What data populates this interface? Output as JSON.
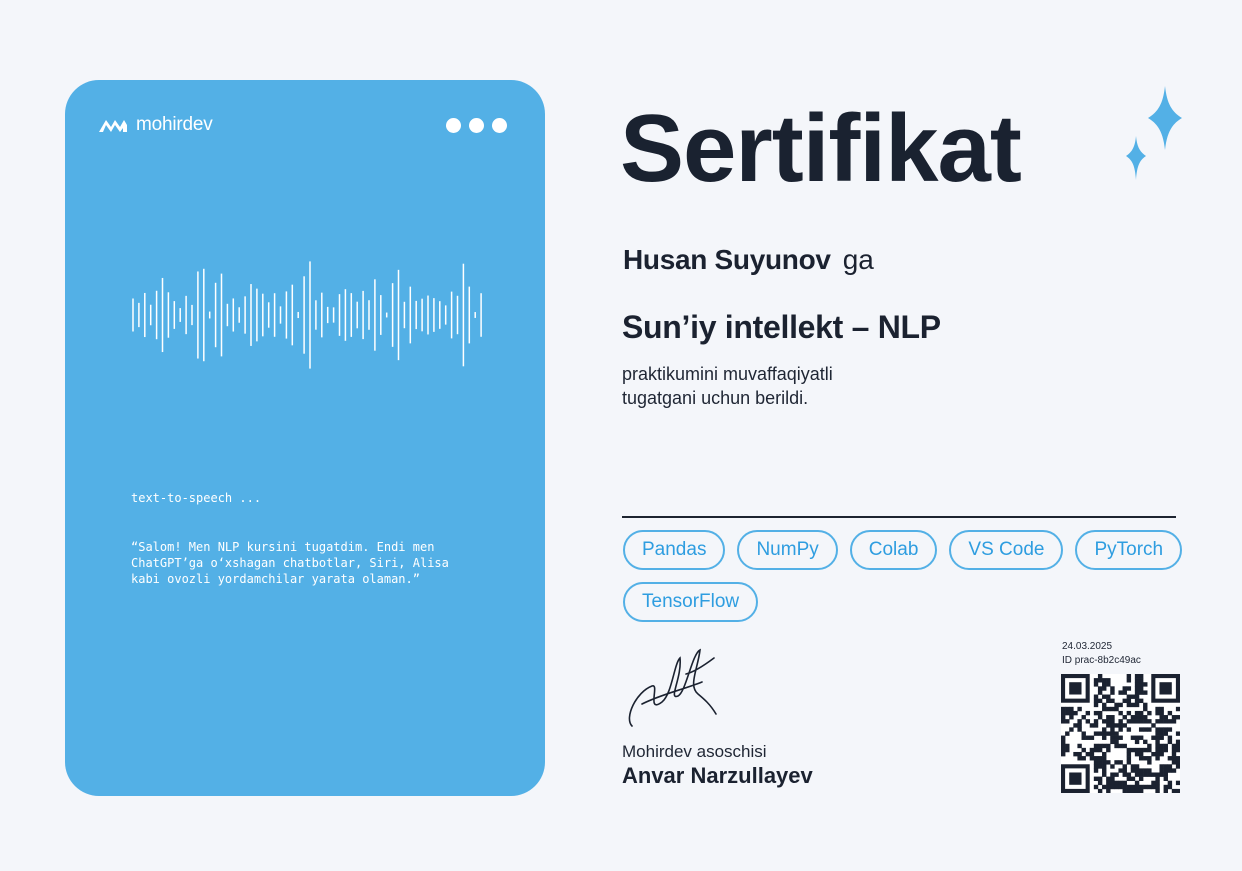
{
  "brand": {
    "name": "mohirdev"
  },
  "card": {
    "caption": "text-to-speech ...",
    "quote_lines": [
      "“Salom! Men NLP kursini tugatdim. Endi men",
      "ChatGPT’ga o‘xshagan chatbotlar, Siri, Alisa",
      "kabi ovozli yordamchilar yarata olaman.”"
    ]
  },
  "certificate": {
    "title": "Sertifikat",
    "recipient": "Husan Suyunov",
    "recipient_suffix": "ga",
    "course": "Sun’iy intellekt – NLP",
    "description_lines": [
      "praktikumini muvaffaqiyatli",
      "tugatgani uchun berildi."
    ],
    "tags": [
      "Pandas",
      "NumPy",
      "Colab",
      "VS Code",
      "PyTorch",
      "TensorFlow"
    ]
  },
  "founder": {
    "role": "Mohirdev asoschisi",
    "name": "Anvar Narzullayev"
  },
  "meta": {
    "date": "24.03.2025",
    "id": "ID prac-8b2c49ac"
  },
  "colors": {
    "accent": "#53b0e6",
    "text": "#1b2230",
    "background": "#f4f6fa"
  },
  "icons": [
    "mohirdev-logo-icon",
    "sparkle-icon",
    "signature-icon",
    "qr-code-icon"
  ]
}
